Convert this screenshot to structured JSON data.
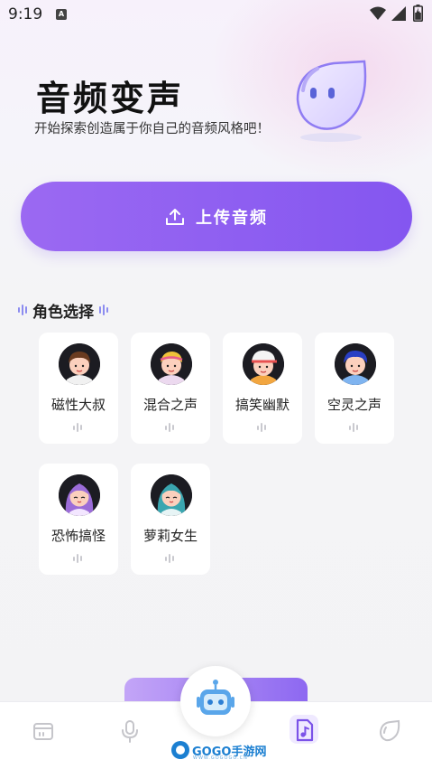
{
  "status_bar": {
    "time": "9:19",
    "notification_letter": "A"
  },
  "hero": {
    "title": "音频变声",
    "subtitle": "开始探索创造属于你自己的音频风格吧！"
  },
  "upload": {
    "label": "上传音频"
  },
  "roles": {
    "section_title": "角色选择",
    "items": [
      {
        "name": "磁性大叔",
        "avatar_icon": "uncle-avatar-icon"
      },
      {
        "name": "混合之声",
        "avatar_icon": "mixed-voice-avatar-icon"
      },
      {
        "name": "搞笑幽默",
        "avatar_icon": "funny-avatar-icon"
      },
      {
        "name": "空灵之声",
        "avatar_icon": "ethereal-voice-avatar-icon"
      },
      {
        "name": "恐怖搞怪",
        "avatar_icon": "horror-avatar-icon"
      },
      {
        "name": "萝莉女生",
        "avatar_icon": "loli-girl-avatar-icon"
      }
    ]
  },
  "bottom_nav": {
    "items": [
      "calendar-icon",
      "microphone-icon",
      "robot-icon",
      "music-file-icon",
      "leaf-icon"
    ],
    "active_index": 3
  },
  "watermark": {
    "text": "GOGO手游网",
    "sub": "WWW.GOGOGO.CN"
  },
  "colors": {
    "accent": "#8a5cf1",
    "accent_light": "#c3a5f7",
    "card_bg": "#ffffff",
    "wave": "#8c8cf0"
  }
}
